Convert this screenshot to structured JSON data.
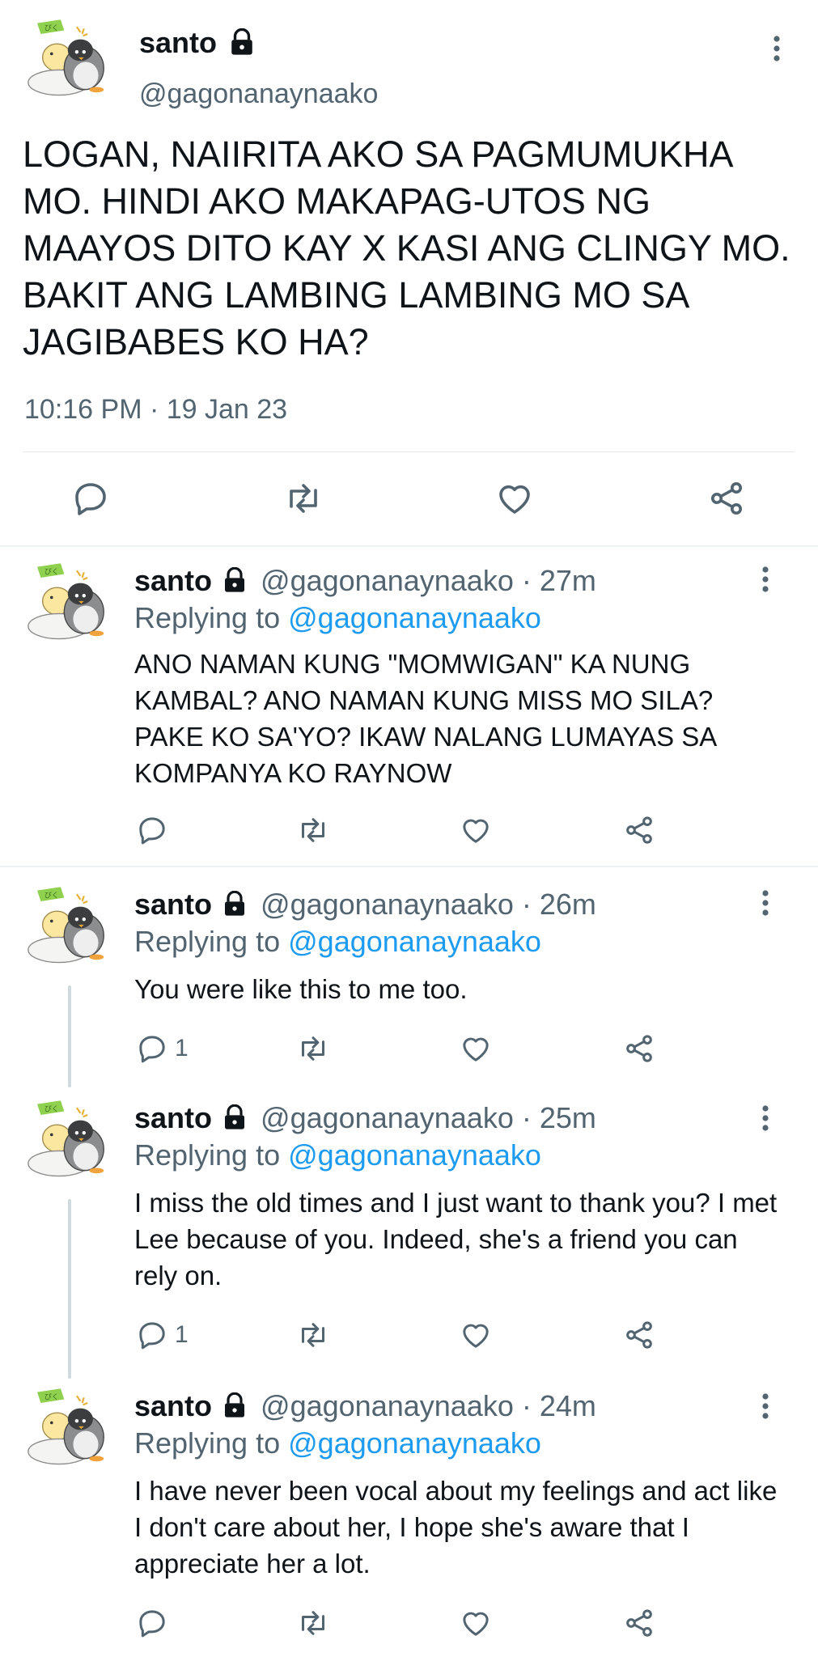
{
  "main_tweet": {
    "display_name": "santo",
    "handle": "@gagonanaynaako",
    "text": "LOGAN, NAIIRITA AKO SA PAGMUMUKHA MO. HINDI AKO MAKAPAG-UTOS NG MAAYOS DITO KAY X KASI ANG CLINGY MO. BAKIT ANG LAMBING LAMBING MO SA JAGIBABES KO HA?",
    "timestamp": "10:16 PM · 19 Jan 23"
  },
  "replies": [
    {
      "display_name": "santo",
      "handle": "@gagonanaynaako",
      "time": "· 27m",
      "replying_prefix": "Replying to",
      "replying_to": "@gagonanaynaako",
      "text": "ANO NAMAN KUNG \"MOMWIGAN\" KA NUNG KAMBAL? ANO NAMAN KUNG MISS MO SILA? PAKE KO SA'YO? IKAW NALANG LUMAYAS SA KOMPANYA KO RAYNOW",
      "reply_count": ""
    },
    {
      "display_name": "santo",
      "handle": "@gagonanaynaako",
      "time": "· 26m",
      "replying_prefix": "Replying to",
      "replying_to": "@gagonanaynaako",
      "text": "You were like this to me too.",
      "reply_count": "1"
    },
    {
      "display_name": "santo",
      "handle": "@gagonanaynaako",
      "time": "· 25m",
      "replying_prefix": "Replying to",
      "replying_to": "@gagonanaynaako",
      "text": "I miss the old times and I just want to thank you? I met Lee because of you. Indeed, she's a friend you can rely on.",
      "reply_count": "1"
    },
    {
      "display_name": "santo",
      "handle": "@gagonanaynaako",
      "time": "· 24m",
      "replying_prefix": "Replying to",
      "replying_to": "@gagonanaynaako",
      "text": "I have never been vocal about my feelings and act like I don't care about her, I hope she's aware that I appreciate her a lot.",
      "reply_count": ""
    }
  ],
  "avatar_badge": "ぴく",
  "icons": [
    "reply-icon",
    "retweet-icon",
    "like-icon",
    "share-icon",
    "lock-icon",
    "more-icon"
  ],
  "colors": {
    "link": "#1d9bf0",
    "muted": "#536471",
    "text": "#0f1419",
    "divider": "#e6e9eb"
  }
}
